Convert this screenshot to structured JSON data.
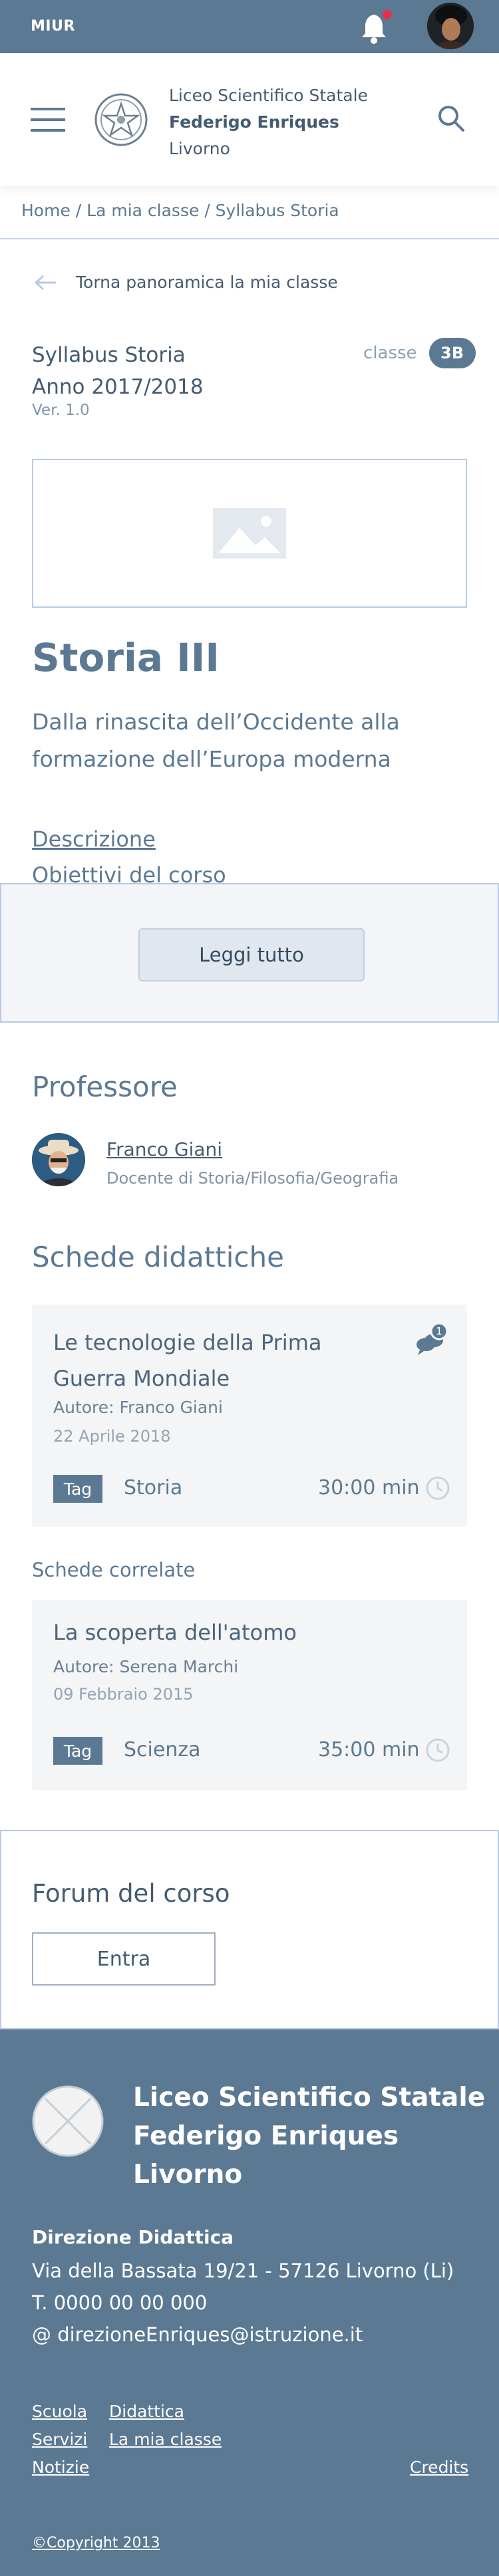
{
  "topbar": {
    "brand": "MIUR",
    "notification_count": 1
  },
  "header": {
    "school_line1": "Liceo Scientifico Statale",
    "school_line2": "Federigo Enriques",
    "school_line3": "Livorno"
  },
  "breadcrumb": "Home / La mia classe / Syllabus Storia",
  "back_link": "Torna panoramica la mia classe",
  "syllabus": {
    "title": "Syllabus Storia",
    "year": "Anno 2017/2018",
    "version": "Ver. 1.0",
    "class_label": "classe",
    "class_value": "3B"
  },
  "course": {
    "title": "Storia III",
    "subtitle": "Dalla rinascita dell’Occidente alla formazione dell’Europa moderna"
  },
  "toc": {
    "item1": "Descrizione",
    "item2": "Obiettivi del corso"
  },
  "read_more": "Leggi tutto",
  "professor": {
    "section_title": "Professore",
    "name": "Franco Giani",
    "role": "Docente di Storia/Filosofia/Geografia"
  },
  "schede": {
    "section_title": "Schede didattiche",
    "card1": {
      "title": "Le tecnologie della Prima Guerra Mondiale",
      "author_label": "Autore:",
      "author": "Franco Giani",
      "date": "22 Aprile 2018",
      "tag": "Tag",
      "subject": "Storia",
      "duration": "30:00 min",
      "comments": "1"
    },
    "related_label": "Schede correlate",
    "card2": {
      "title": "La scoperta dell'atomo",
      "author_label": "Autore:",
      "author": "Serena Marchi",
      "date": "09 Febbraio 2015",
      "tag": "Tag",
      "subject": "Scienza",
      "duration": "35:00 min"
    }
  },
  "forum": {
    "title": "Forum del corso",
    "button": "Entra"
  },
  "footer": {
    "school_line1": "Liceo Scientifico Statale",
    "school_line2": "Federigo Enriques",
    "school_line3": "Livorno",
    "dir_title": "Direzione Didattica",
    "address": "Via della Bassata 19/21 - 57126 Livorno (Li)",
    "phone": "T. 0000 00 00 000",
    "email": "@ direzioneEnriques@istruzione.it",
    "links": {
      "scuola": "Scuola",
      "didattica": "Didattica",
      "servizi": "Servizi",
      "la_mia_classe": "La mia classe",
      "notizie": "Notizie",
      "credits": "Credits"
    },
    "copyright": "©Copyright 2013"
  },
  "colors": {
    "primary": "#5c7993",
    "text": "#455b71",
    "notification": "#e5304b",
    "card_bg": "#f4f5f6",
    "border": "#b7c9e6"
  }
}
